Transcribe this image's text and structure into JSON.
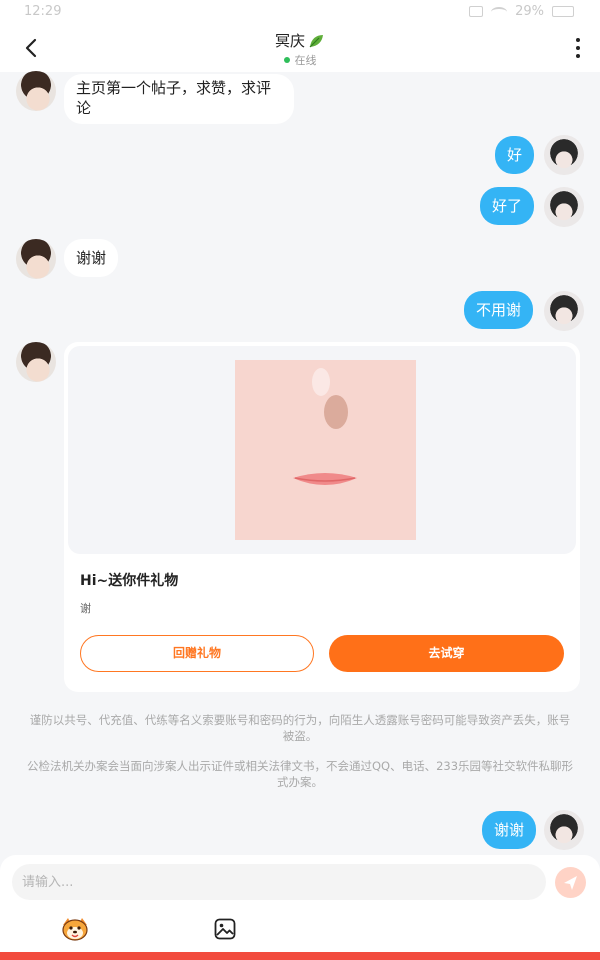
{
  "status_bar": {
    "time": "12:29",
    "battery": "29%"
  },
  "header": {
    "contact_name": "冥庆",
    "presence": "在线"
  },
  "messages": [
    {
      "side": "left",
      "text": "主页第一个帖子，求赞，求评论"
    },
    {
      "side": "right",
      "text": "好"
    },
    {
      "side": "right",
      "text": "好了"
    },
    {
      "side": "left",
      "text": "谢谢"
    },
    {
      "side": "right",
      "text": "不用谢"
    },
    {
      "side": "right",
      "text": "谢谢"
    }
  ],
  "gift_card": {
    "title": "Hi~送你件礼物",
    "message": "谢",
    "return_gift_label": "回赠礼物",
    "try_on_label": "去试穿"
  },
  "notices": [
    "谨防以共号、代充值、代练等名义索要账号和密码的行为，向陌生人透露账号密码可能导致资产丢失，账号被盗。",
    "公检法机关办案会当面向涉案人出示证件或相关法律文书，不会通过QQ、电话、233乐园等社交软件私聊形式办案。"
  ],
  "composer": {
    "placeholder": "请输入..."
  },
  "colors": {
    "outgoing_bubble": "#34b4f5",
    "accent_orange": "#ff7018",
    "online_dot": "#2fbe5a",
    "bottom_strip": "#f24b3e"
  },
  "icons": [
    "back-arrow-icon",
    "leaf-icon",
    "more-vertical-icon",
    "send-icon",
    "emoji-mascot-icon",
    "image-icon"
  ]
}
